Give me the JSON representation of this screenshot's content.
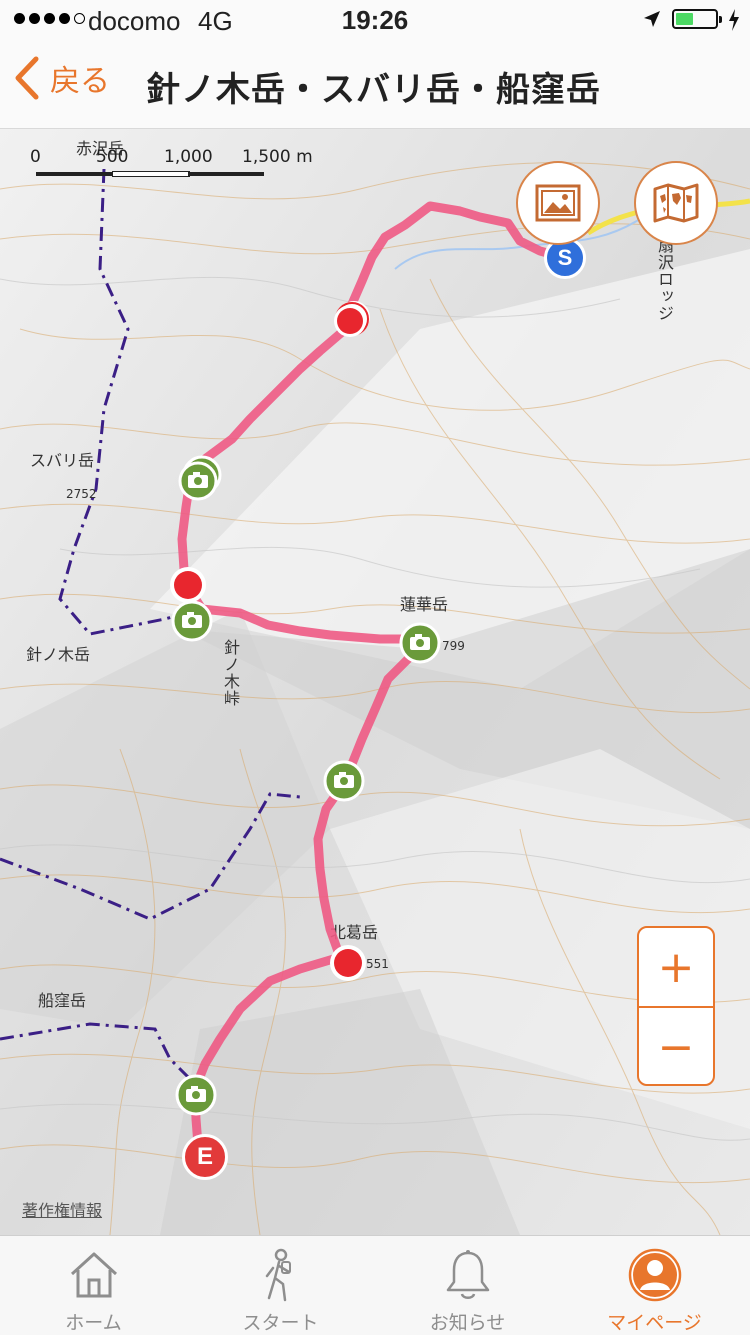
{
  "status_bar": {
    "carrier": "docomo",
    "network": "4G",
    "time": "19:26",
    "signal_bars_filled": 4,
    "signal_bars_total": 5,
    "battery_level": 0.45
  },
  "header": {
    "back_label": "戻る",
    "title": "針ノ木岳・スバリ岳・船窪岳"
  },
  "map": {
    "scale": {
      "ticks": [
        "0",
        "500",
        "1,000",
        "1,500 m"
      ]
    },
    "place_labels": {
      "akasawa": "赤沢岳",
      "subari": "スバリ岳",
      "subari_elev": "2752",
      "harinoki": "針ノ木岳",
      "harinoki_pass": "針ノ木峠",
      "renge": "蓮華岳",
      "renge_elev": "799",
      "kita_kuzu": "北葛岳",
      "kita_kuzu_elev": "551",
      "funakubo": "船窪岳",
      "ogisawa_lodge": "扇沢ロッジ"
    },
    "markers": {
      "start": "S",
      "end": "E"
    },
    "copyright_label": "著作権情報",
    "zoom_in": "+",
    "zoom_out": "−",
    "colors": {
      "route": "#ee5a84",
      "start_marker": "#2f6fdb",
      "end_marker": "#e23a3a",
      "waypoint_red": "#e8262e",
      "photo_marker": "#6a9a3a",
      "accent": "#e8762c"
    }
  },
  "tab_bar": {
    "items": [
      {
        "label": "ホーム",
        "icon": "home-icon",
        "active": false
      },
      {
        "label": "スタート",
        "icon": "hiker-icon",
        "active": false
      },
      {
        "label": "お知らせ",
        "icon": "bell-icon",
        "active": false
      },
      {
        "label": "マイページ",
        "icon": "person-icon",
        "active": true
      }
    ]
  }
}
